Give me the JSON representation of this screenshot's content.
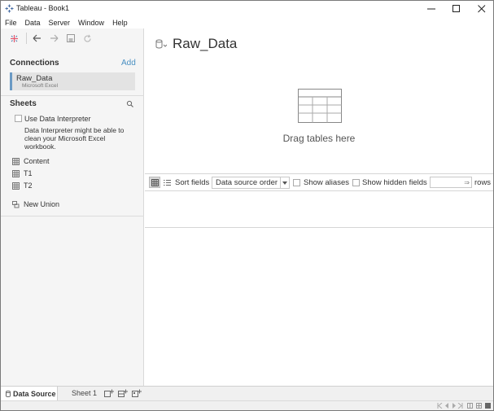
{
  "window": {
    "title": "Tableau - Book1",
    "minimize_icon": "minimize-icon",
    "maximize_icon": "maximize-icon",
    "close_icon": "close-icon"
  },
  "menu": {
    "items": [
      "File",
      "Data",
      "Server",
      "Window",
      "Help"
    ]
  },
  "colors": {
    "accent_link": "#4a90c2",
    "selected_connection_border": "#6b9ac4",
    "tableau_logo": "#e2556b"
  },
  "sidebar": {
    "connections_heading": "Connections",
    "add_label": "Add",
    "connection": {
      "name": "Raw_Data",
      "type": "Microsoft Excel"
    },
    "sheets_heading": "Sheets",
    "use_interpreter_label": "Use Data Interpreter",
    "interpreter_description": "Data Interpreter might be able to clean your Microsoft Excel workbook.",
    "sheets": [
      "Content",
      "T1",
      "T2"
    ],
    "new_union_label": "New Union"
  },
  "main": {
    "datasource_title": "Raw_Data",
    "drag_hint": "Drag tables here",
    "grid_toolbar": {
      "sort_label": "Sort fields",
      "sort_value": "Data source order",
      "show_aliases_label": "Show aliases",
      "show_hidden_label": "Show hidden fields",
      "rows_label": "rows"
    }
  },
  "tabs": {
    "datasource_label": "Data Source",
    "sheet1_label": "Sheet 1"
  }
}
